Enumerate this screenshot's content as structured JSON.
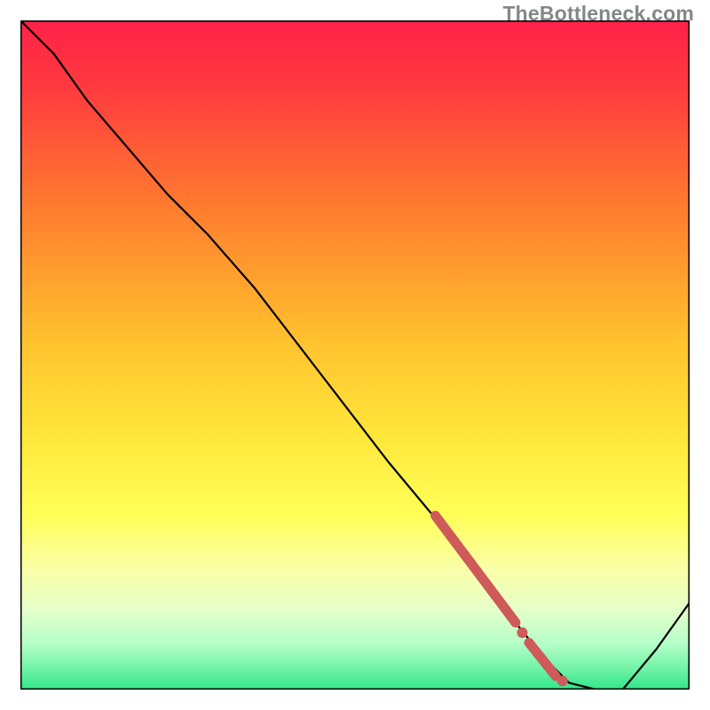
{
  "watermark": {
    "text": "TheBottleneck.com"
  },
  "chart_data": {
    "type": "line",
    "title": "",
    "xlabel": "",
    "ylabel": "",
    "xlim": [
      0,
      100
    ],
    "ylim": [
      0,
      100
    ],
    "grid": false,
    "legend": false,
    "background_gradient": {
      "top_color": "#ff2b4a",
      "mid_upper_color": "#ffed3c",
      "mid_lower_color": "#f6ffb8",
      "bottom_color": "#2fe689"
    },
    "series": [
      {
        "name": "bottleneck-curve",
        "color": "#000000",
        "x": [
          0,
          5,
          10,
          16,
          22,
          25,
          28,
          35,
          45,
          55,
          65,
          70,
          74,
          78,
          82,
          86,
          90,
          95,
          100
        ],
        "y": [
          100,
          95,
          88,
          81,
          74,
          71,
          68,
          60,
          47,
          34,
          22,
          16,
          10,
          5,
          1,
          0,
          0,
          6,
          13
        ]
      }
    ],
    "highlight_points": {
      "name": "selected-range",
      "color": "#cf5a5a",
      "segments": [
        {
          "x": [
            62,
            74
          ],
          "y": [
            26,
            10
          ],
          "thick": true
        },
        {
          "x": [
            76,
            80
          ],
          "y": [
            7,
            2
          ],
          "thick": true
        }
      ],
      "dots": [
        {
          "x": 75,
          "y": 8.5
        },
        {
          "x": 81,
          "y": 1.3
        }
      ]
    }
  }
}
